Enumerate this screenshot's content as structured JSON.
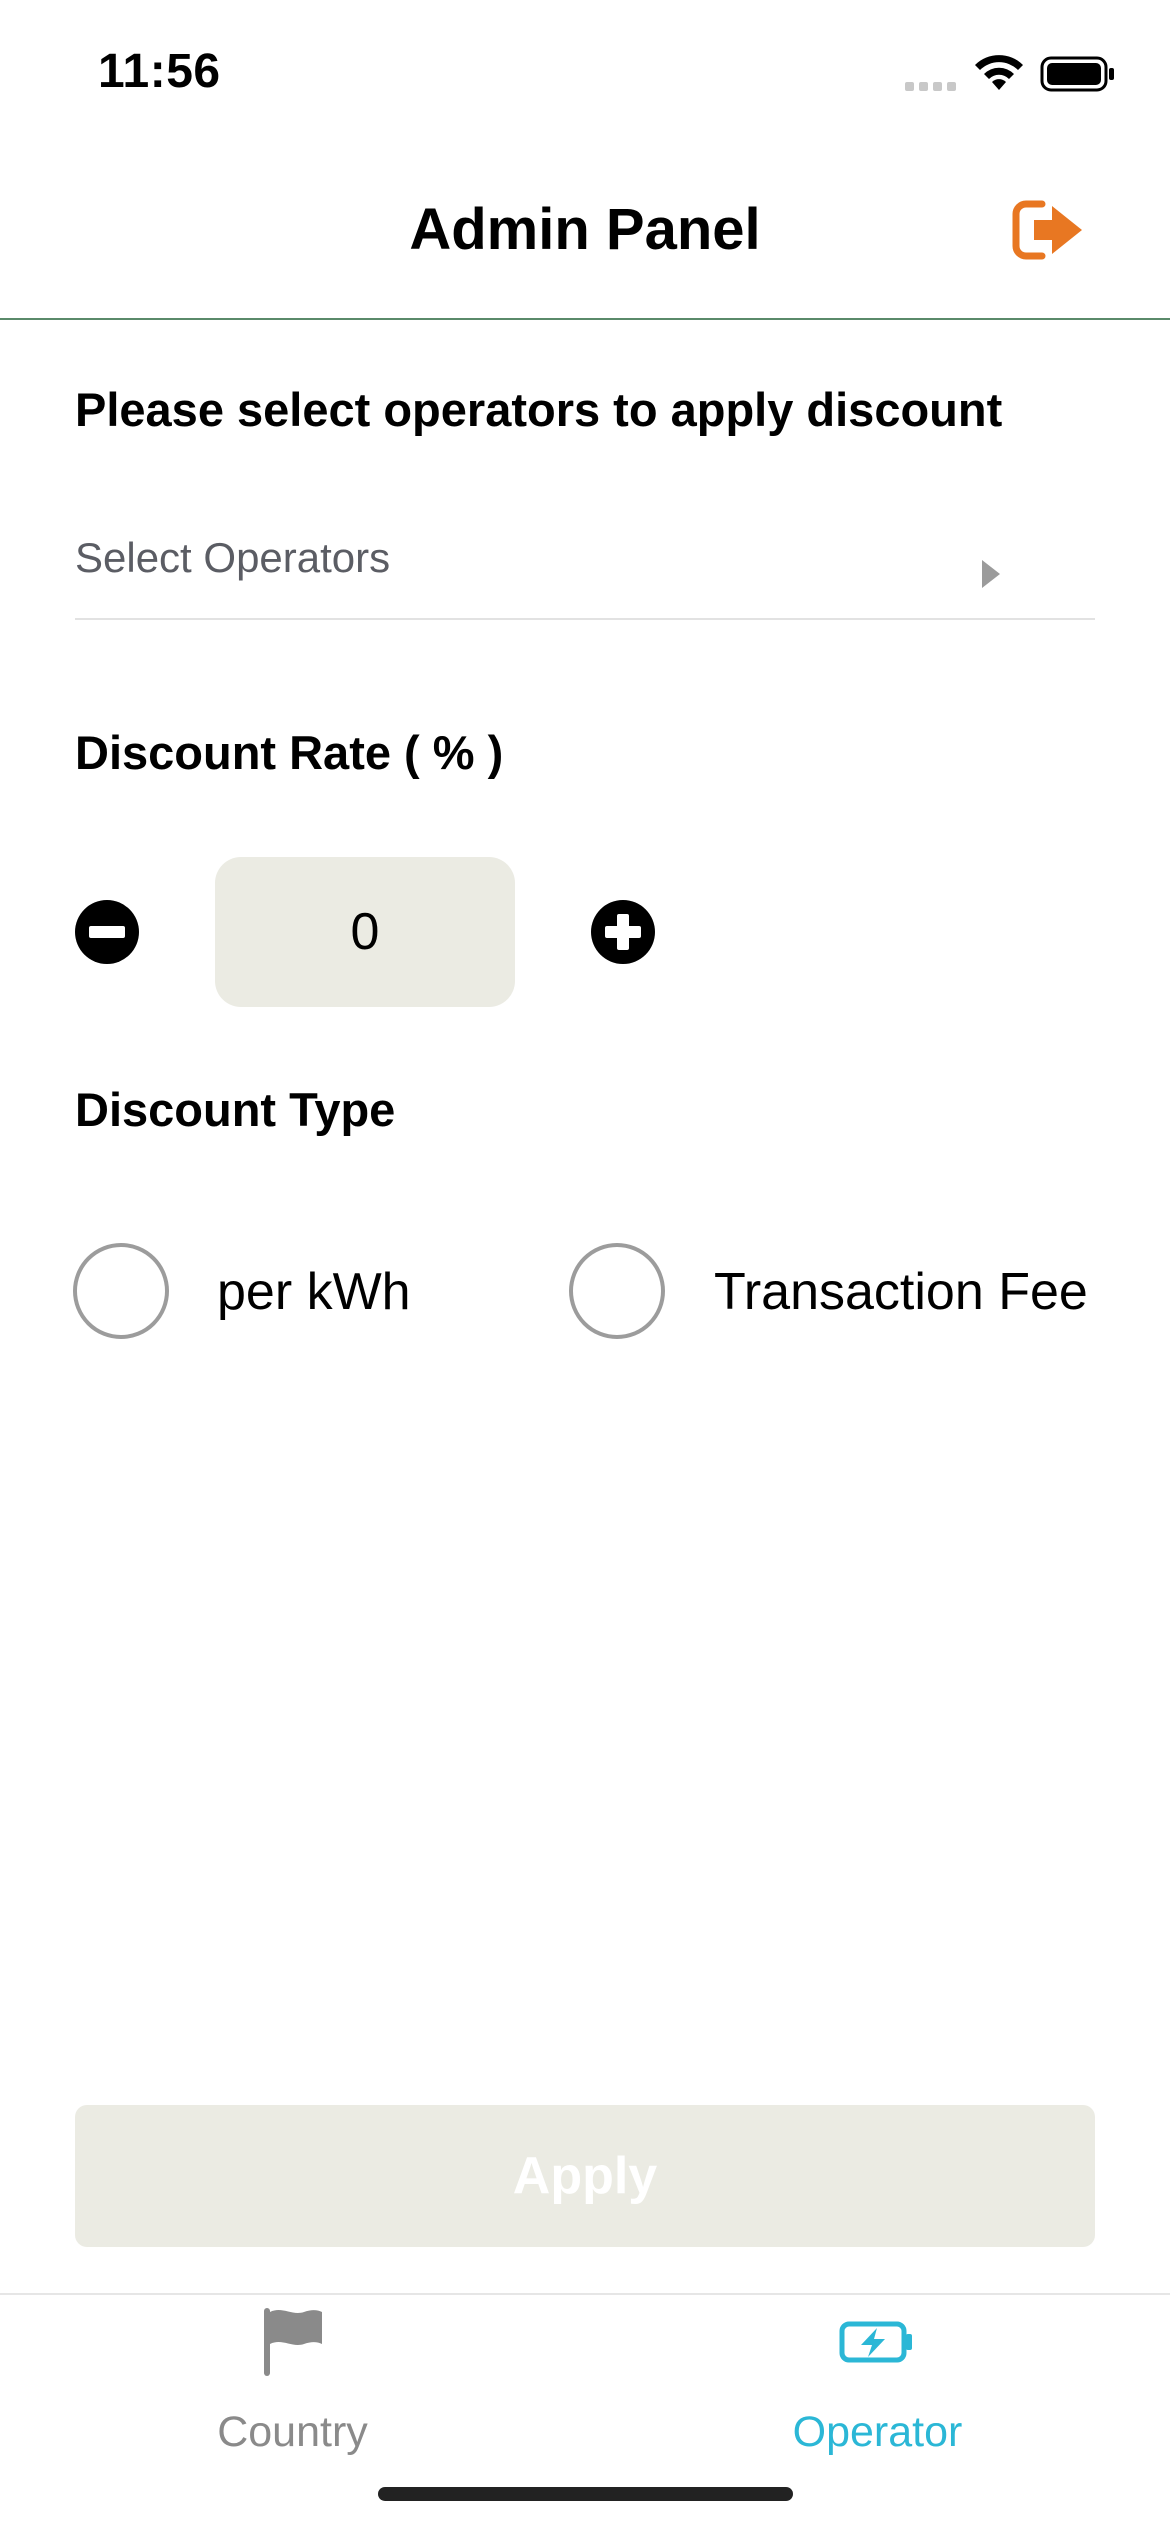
{
  "status_bar": {
    "time": "11:56"
  },
  "header": {
    "title": "Admin Panel",
    "logout_icon": "logout-icon",
    "accent_color": "#e87722"
  },
  "operators": {
    "label": "Please select operators to apply discount",
    "placeholder": "Select Operators"
  },
  "discount_rate": {
    "label": "Discount Rate ( % )",
    "value": "0"
  },
  "discount_type": {
    "label": "Discount Type",
    "options": [
      {
        "label": "per kWh",
        "selected": false
      },
      {
        "label": "Transaction Fee",
        "selected": false
      }
    ]
  },
  "apply": {
    "label": "Apply",
    "enabled": false
  },
  "tabs": [
    {
      "label": "Country",
      "icon": "flag-icon",
      "active": false
    },
    {
      "label": "Operator",
      "icon": "battery-bolt-icon",
      "active": true,
      "color": "#2bb7d6"
    }
  ]
}
